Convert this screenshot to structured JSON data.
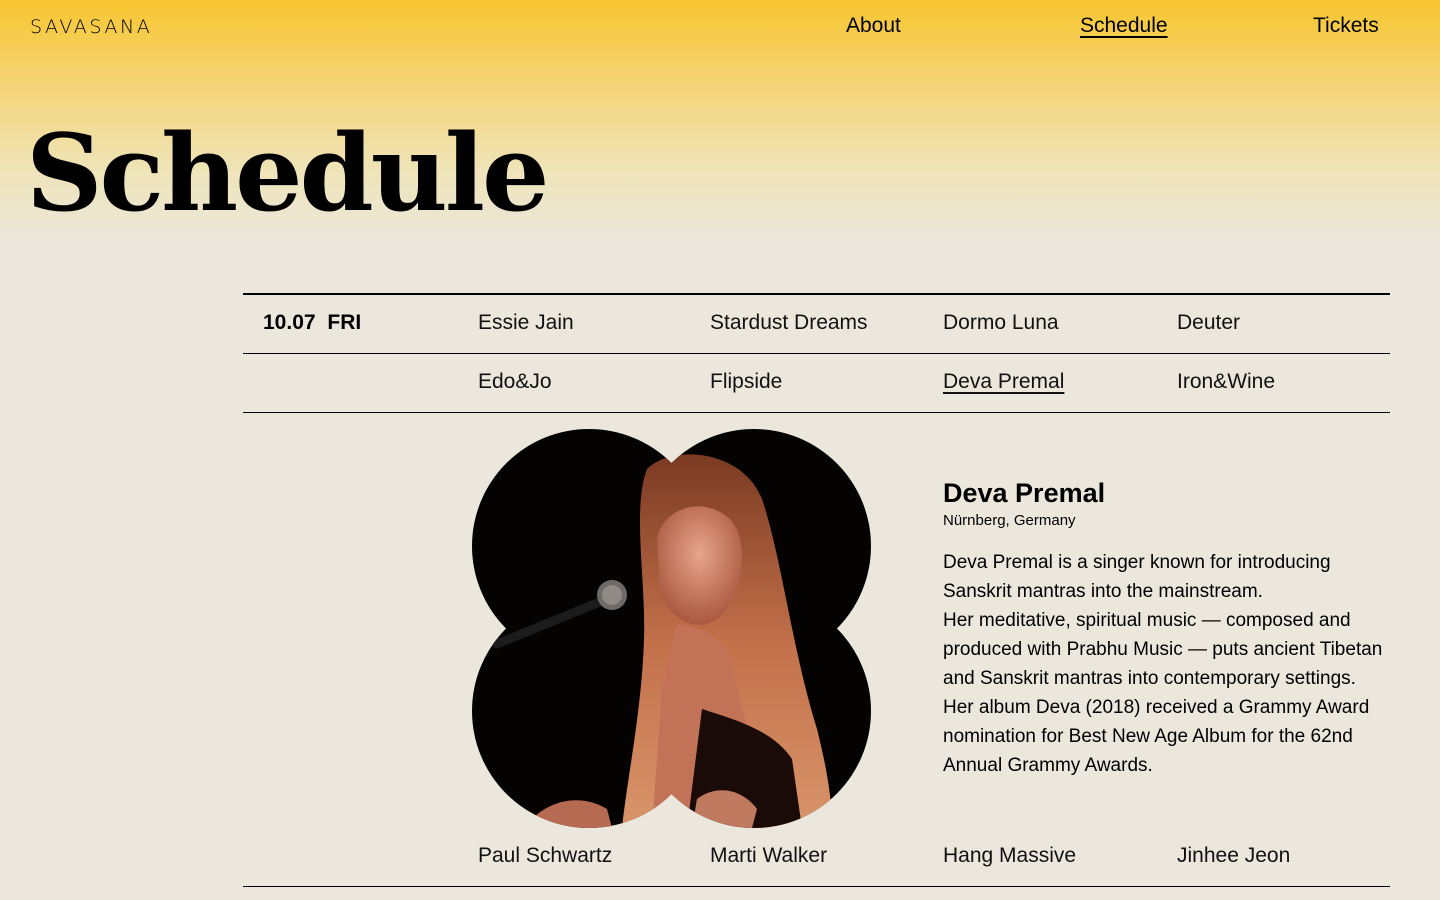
{
  "header": {
    "logo": "SAVASANA",
    "nav": [
      {
        "label": "About",
        "active": false
      },
      {
        "label": "Schedule",
        "active": true
      },
      {
        "label": "Tickets",
        "active": false
      }
    ]
  },
  "page": {
    "title": "Schedule"
  },
  "schedule": {
    "date": "10.07 FRI",
    "rows": [
      [
        "Essie Jain",
        "Stardust Dreams",
        "Dormo Luna",
        "Deuter"
      ],
      [
        "Edo&Jo",
        "Flipside",
        "Deva Premal",
        "Iron&Wine"
      ],
      [
        "Paul Schwartz",
        "Marti Walker",
        "Hang Massive",
        "Jinhee Jeon"
      ]
    ],
    "selected": "Deva Premal"
  },
  "artist": {
    "name": "Deva Premal",
    "location": "Nürnberg, Germany",
    "bio": [
      "Deva Premal is a singer known for introducing Sanskrit mantras into the mainstream.",
      "Her meditative, spiritual music — composed and produced with Prabhu Music — puts ancient Tibetan and Sanskrit mantras into contemporary settings.",
      "Her album Deva (2018) received a Grammy Award nomination for Best New Age Album for the 62nd Annual Grammy Awards."
    ]
  },
  "colors": {
    "gradient_top": "#f8c630",
    "background": "#ebe7dc",
    "text": "#000000"
  }
}
